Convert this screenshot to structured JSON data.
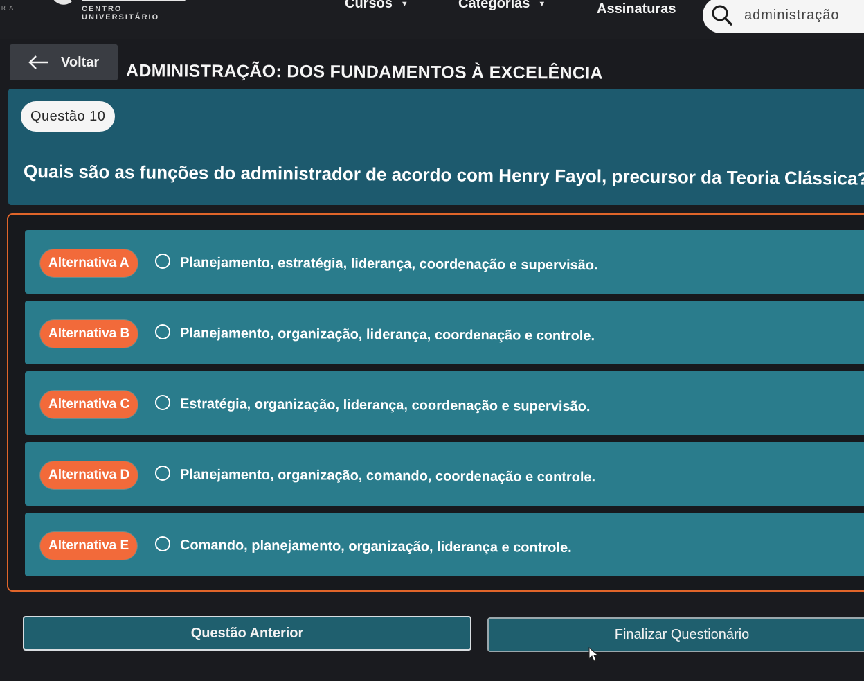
{
  "nav": {
    "corner_text": "R A",
    "logo_subtitle": "CENTRO UNIVERSITÁRIO",
    "items": [
      {
        "label": "Cursos",
        "has_dropdown": true
      },
      {
        "label": "Categorias",
        "has_dropdown": true
      },
      {
        "label": "Assinaturas",
        "has_dropdown": false
      }
    ],
    "search": {
      "value": "administração",
      "icon": "search-icon"
    }
  },
  "header": {
    "back_label": "Voltar",
    "back_icon": "arrow-left-icon",
    "course_title": "ADMINISTRAÇÃO: DOS FUNDAMENTOS À EXCELÊNCIA"
  },
  "question": {
    "badge": "Questão 10",
    "text": "Quais são as funções do administrador de acordo com Henry Fayol, precursor da Teoria Clássica?"
  },
  "answers": [
    {
      "badge": "Alternativa A",
      "text": "Planejamento, estratégia, liderança, coordenação e supervisão.",
      "selected": false
    },
    {
      "badge": "Alternativa B",
      "text": "Planejamento, organização, liderança, coordenação e controle.",
      "selected": false
    },
    {
      "badge": "Alternativa C",
      "text": "Estratégia, organização, liderança, coordenação e supervisão.",
      "selected": false
    },
    {
      "badge": "Alternativa D",
      "text": "Planejamento, organização, comando, coordenação e controle.",
      "selected": false
    },
    {
      "badge": "Alternativa E",
      "text": "Comando, planejamento, organização, liderança e controle.",
      "selected": false
    }
  ],
  "footer": {
    "prev_label": "Questão Anterior",
    "finish_label": "Finalizar Questionário"
  },
  "colors": {
    "panel": "#1d5a6e",
    "answer": "#2a7c8c",
    "badge": "#f26a3a",
    "frame_border": "#e0652a",
    "background": "#1a1b1f"
  }
}
